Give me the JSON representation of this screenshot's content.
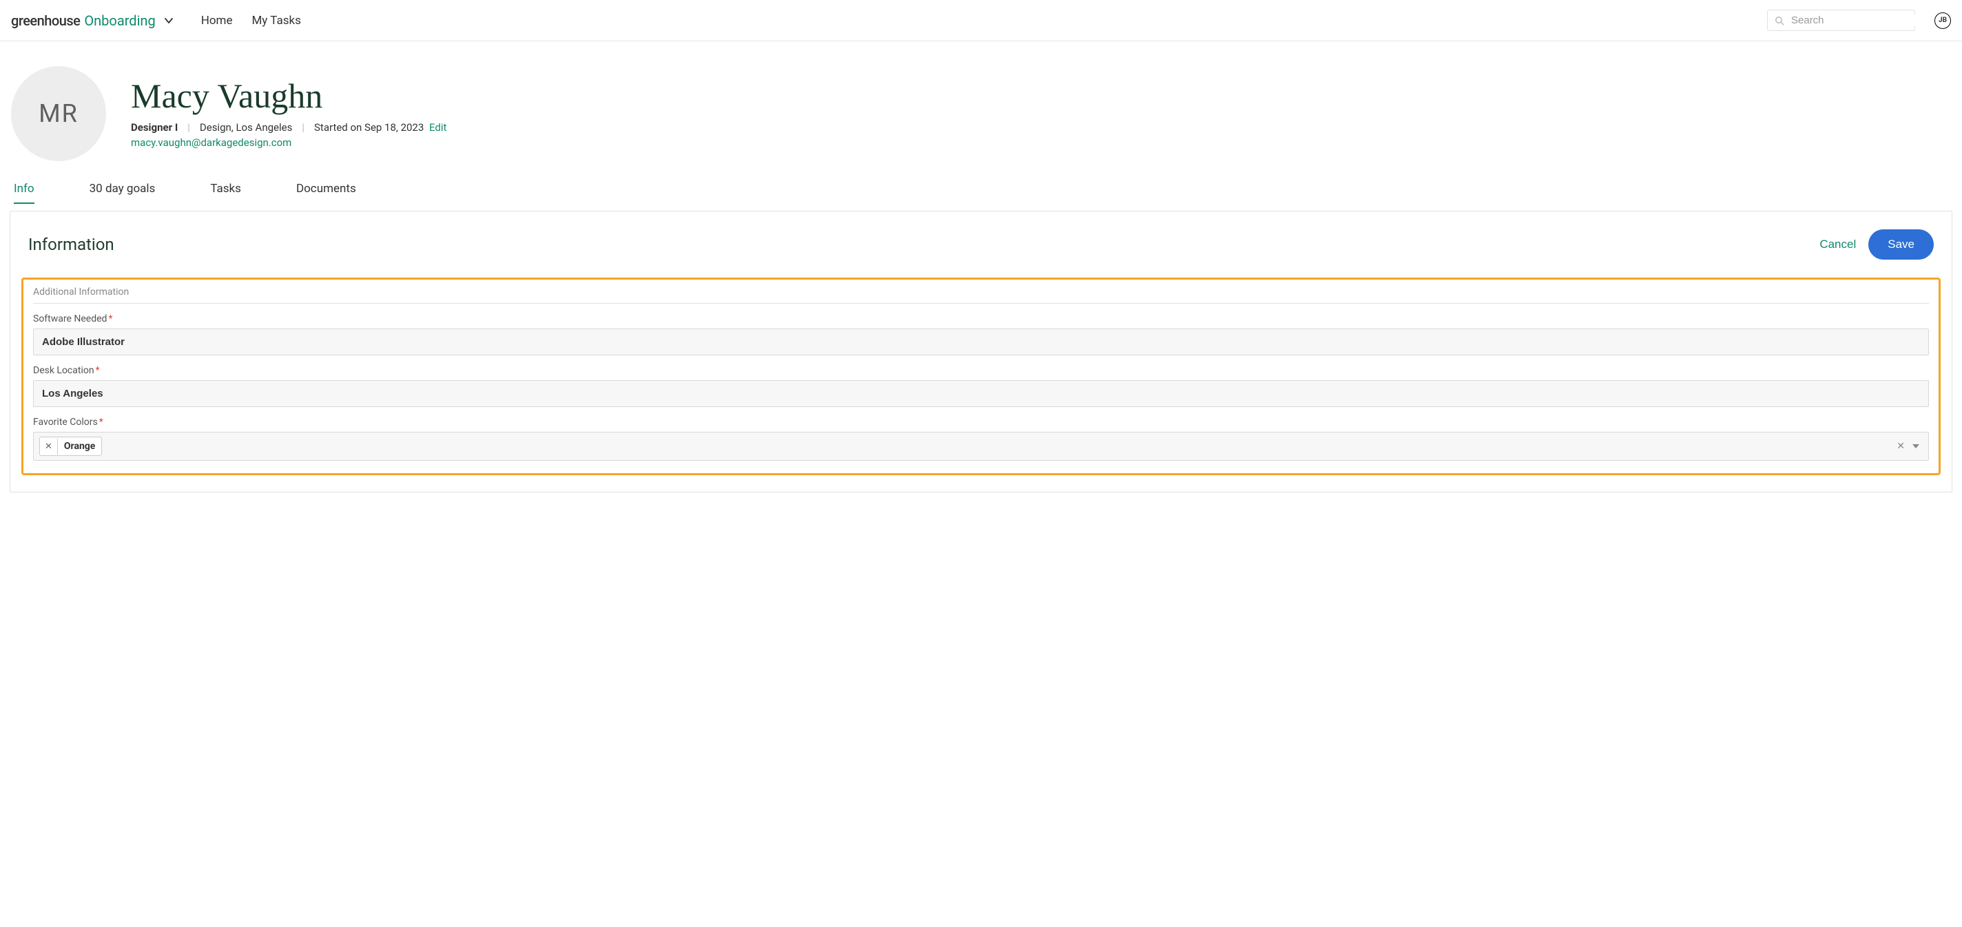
{
  "header": {
    "brand_main": "greenhouse",
    "brand_sub": "Onboarding",
    "nav": {
      "home": "Home",
      "my_tasks": "My Tasks"
    },
    "search_placeholder": "Search",
    "user_initials": "JB"
  },
  "profile": {
    "avatar_initials": "MR",
    "name": "Macy Vaughn",
    "title": "Designer I",
    "dept_loc": "Design, Los Angeles",
    "started": "Started on Sep 18, 2023",
    "edit_label": "Edit",
    "email": "macy.vaughn@darkagedesign.com"
  },
  "tabs": {
    "info": "Info",
    "goals": "30 day goals",
    "tasks": "Tasks",
    "documents": "Documents"
  },
  "panel": {
    "title": "Information",
    "cancel": "Cancel",
    "save": "Save",
    "section_title": "Additional Information",
    "fields": {
      "software": {
        "label": "Software Needed",
        "value": "Adobe Illustrator"
      },
      "desk": {
        "label": "Desk Location",
        "value": "Los Angeles"
      },
      "colors": {
        "label": "Favorite Colors",
        "tag": "Orange"
      }
    }
  }
}
